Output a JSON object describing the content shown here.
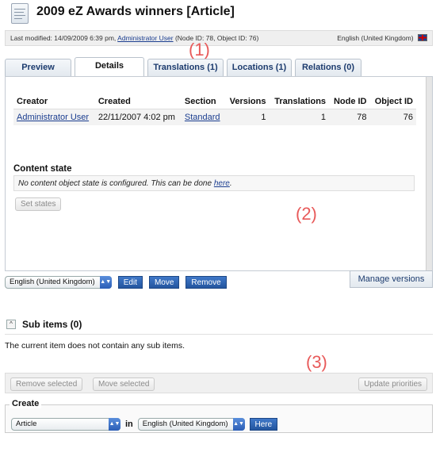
{
  "header": {
    "title": "2009 eZ Awards winners [Article]",
    "meta": {
      "last_modified_prefix": "Last modified: 14/09/2009 6:39 pm,",
      "author_link": "Administrator User",
      "ids": "(Node ID: 78, Object ID: 76)",
      "language": "English (United Kingdom)"
    }
  },
  "tabs": [
    {
      "label": "Preview"
    },
    {
      "label": "Details"
    },
    {
      "label": "Translations (1)"
    },
    {
      "label": "Locations (1)"
    },
    {
      "label": "Relations (0)"
    }
  ],
  "details_table": {
    "headers": [
      "Creator",
      "Created",
      "Section",
      "Versions",
      "Translations",
      "Node ID",
      "Object ID"
    ],
    "row": {
      "creator": "Administrator User",
      "created": "22/11/2007 4:02 pm",
      "section": "Standard",
      "versions": "1",
      "translations": "1",
      "node_id": "78",
      "object_id": "76"
    }
  },
  "content_state": {
    "title": "Content state",
    "message": "No content object state is configured. This can be done",
    "link": "here",
    "suffix": ".",
    "button": "Set states"
  },
  "panel_controls": {
    "language_select": "English (United Kingdom)",
    "edit": "Edit",
    "move": "Move",
    "remove": "Remove",
    "manage_versions": "Manage versions"
  },
  "annotations": {
    "one": "(1)",
    "two": "(2)",
    "three": "(3)"
  },
  "sub_items": {
    "toggle": "^",
    "title": "Sub items (0)",
    "message": "The current item does not contain any sub items.",
    "remove_selected": "Remove selected",
    "move_selected": "Move selected",
    "update_priorities": "Update priorities"
  },
  "create": {
    "legend": "Create",
    "class_select": "Article",
    "in_label": "in",
    "language_select": "English (United Kingdom)",
    "here_button": "Here"
  }
}
